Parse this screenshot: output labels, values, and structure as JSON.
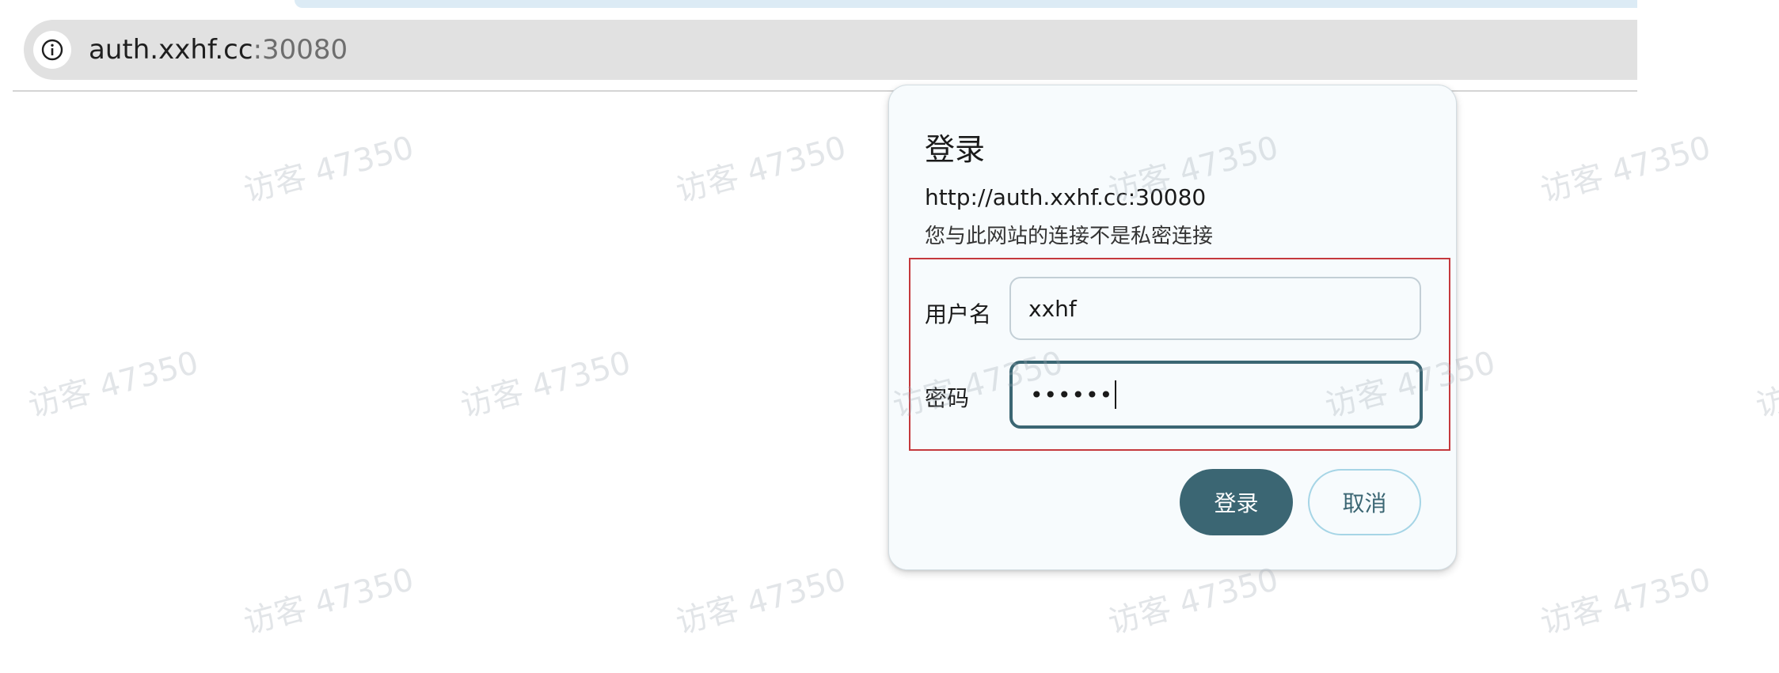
{
  "browser": {
    "url_host": "auth.xxhf.cc",
    "url_port": ":30080",
    "site_info_icon": "info-circle-icon"
  },
  "dialog": {
    "title": "登录",
    "origin": "http://auth.xxhf.cc:30080",
    "warning": "您与此网站的连接不是私密连接",
    "username_label": "用户名",
    "username_value": "xxhf",
    "password_label": "密码",
    "password_value": "••••••",
    "login_button": "登录",
    "cancel_button": "取消"
  },
  "watermark": {
    "text": "访客 47350"
  },
  "colors": {
    "accent": "#3b6673",
    "highlight_border": "#c5393d",
    "cancel_border": "#a6d5e6",
    "dialog_bg": "#f7fbfd",
    "address_bar_bg": "#e1e1e1"
  }
}
